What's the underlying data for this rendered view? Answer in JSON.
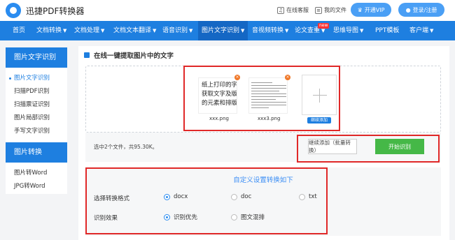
{
  "header": {
    "app_name": "迅捷PDF转换器",
    "support_label": "在线客服",
    "files_label": "我的文件",
    "vip_label": "开通VIP",
    "login_label": "登录/注册"
  },
  "nav": {
    "items": [
      {
        "label": "首页",
        "dropdown": false
      },
      {
        "label": "文档转换",
        "dropdown": true
      },
      {
        "label": "文档处理",
        "dropdown": true
      },
      {
        "label": "文档文本翻译",
        "dropdown": true
      },
      {
        "label": "语音识别",
        "dropdown": true
      },
      {
        "label": "图片文字识别",
        "dropdown": true,
        "active": true
      },
      {
        "label": "音视频转换",
        "dropdown": true
      },
      {
        "label": "论文查重",
        "dropdown": true,
        "badge": "new"
      },
      {
        "label": "思维导图",
        "dropdown": true
      },
      {
        "label": "PPT模板",
        "dropdown": false
      },
      {
        "label": "客户端",
        "dropdown": true
      }
    ]
  },
  "sidebar": {
    "section1_title": "图片文字识别",
    "section1_items": [
      "图片文字识别",
      "扫描PDF识别",
      "扫描票证识别",
      "图片局部识别",
      "手写文字识别"
    ],
    "section2_title": "图片转换",
    "section2_items": [
      "图片转Word",
      "JPG转Word"
    ]
  },
  "main": {
    "title": "在线一键提取图片中的文字",
    "files": [
      {
        "name": "xxx.png",
        "preview_text": [
          "纸上打印的字",
          "获取文字及版",
          "的元素和排版。"
        ]
      },
      {
        "name": "xxx3.png"
      }
    ],
    "add_more_tag": "继续添加",
    "file_count": "选中2个文件，共95.30K。",
    "continue_button": "继续添加（批量转换）",
    "start_button": "开始识别"
  },
  "settings": {
    "title": "自定义设置转换如下",
    "format_label": "选择转换格式",
    "format_options": [
      "docx",
      "doc",
      "txt"
    ],
    "format_selected": "docx",
    "effect_label": "识别效果",
    "effect_options": [
      "识别优先",
      "图文混排"
    ],
    "effect_selected": "识别优先"
  },
  "colors": {
    "nav_blue": "#1e7fe0",
    "start_green": "#45b847",
    "highlight_red": "#e02828"
  }
}
